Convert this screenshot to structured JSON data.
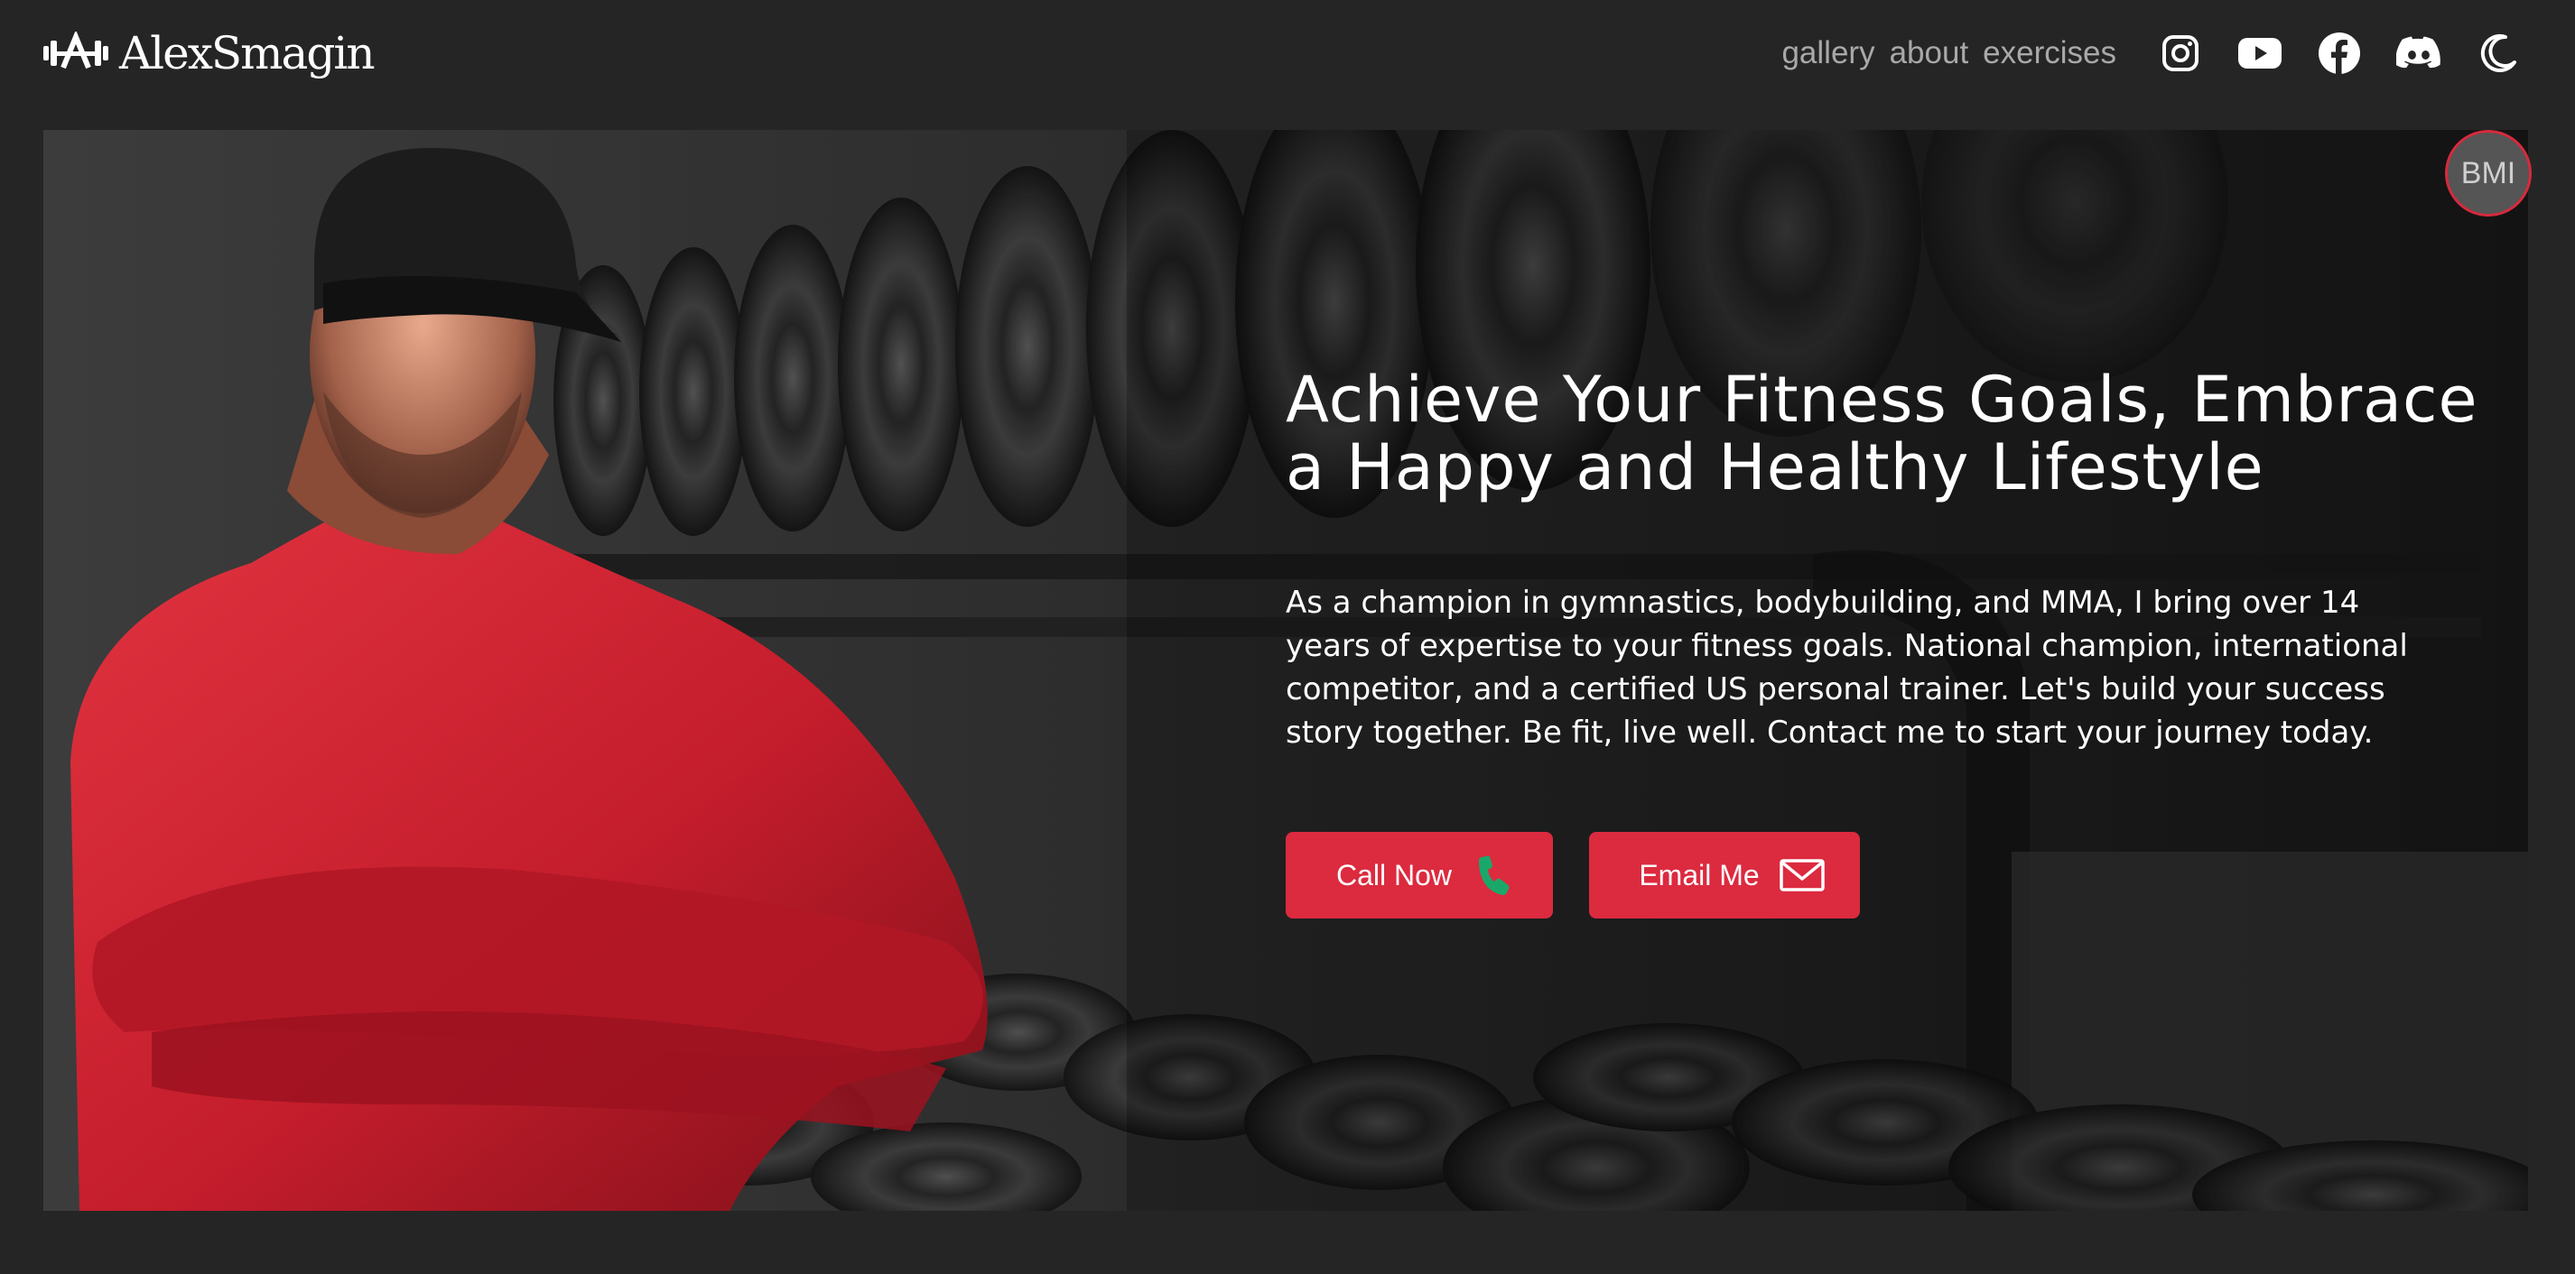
{
  "brand": {
    "name": "AlexSmagin",
    "logo_icon": "dumbbell-A-icon"
  },
  "nav": {
    "links": [
      "gallery",
      "about",
      "exercises"
    ],
    "icons": [
      "instagram-icon",
      "youtube-icon",
      "facebook-icon",
      "discord-icon",
      "moon-icon"
    ]
  },
  "bmi": {
    "label": "BMI"
  },
  "hero": {
    "title": "Achieve Your Fitness Goals, Embrace a Happy and Healthy Lifestyle",
    "text": "As a champion in gymnastics, bodybuilding, and MMA, I bring over 14 years of expertise to your fitness goals. National champion, international competitor, and a certified US personal trainer. Let's build your success story together. Be fit, live well. Contact me to start your journey today.",
    "buttons": {
      "call": {
        "label": "Call Now",
        "icon": "phone-icon"
      },
      "email": {
        "label": "Email Me",
        "icon": "envelope-icon"
      }
    }
  },
  "colors": {
    "background": "#252525",
    "accent": "#dc2a3f",
    "nav_text": "#a9a9a9",
    "phone_icon": "#1aa86a"
  }
}
